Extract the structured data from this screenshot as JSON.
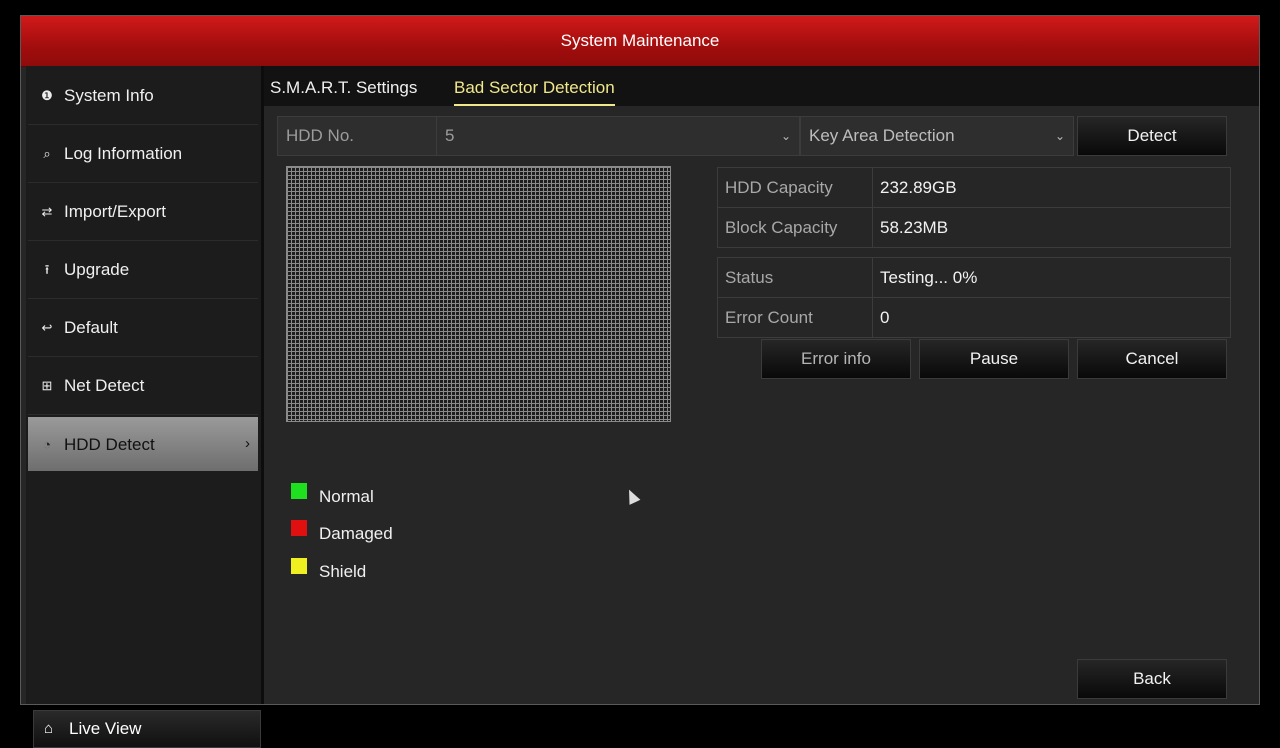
{
  "window": {
    "title": "System Maintenance"
  },
  "sidebar": {
    "items": [
      {
        "label": "System Info",
        "icon": "info-icon",
        "glyph": "❶"
      },
      {
        "label": "Log Information",
        "icon": "log-search-icon",
        "glyph": "⌕"
      },
      {
        "label": "Import/Export",
        "icon": "import-export-icon",
        "glyph": "⇄"
      },
      {
        "label": "Upgrade",
        "icon": "upgrade-arrow-icon",
        "glyph": "⭱"
      },
      {
        "label": "Default",
        "icon": "default-reset-icon",
        "glyph": "↩"
      },
      {
        "label": "Net Detect",
        "icon": "network-icon",
        "glyph": "⊞"
      },
      {
        "label": "HDD Detect",
        "icon": "hdd-detect-icon",
        "glyph": "◔",
        "active": true
      }
    ],
    "live_view": {
      "label": "Live View",
      "icon": "home-icon",
      "glyph": "⌂"
    }
  },
  "tabs": [
    {
      "label": "S.M.A.R.T. Settings",
      "active": false
    },
    {
      "label": "Bad Sector Detection",
      "active": true
    }
  ],
  "controls": {
    "hdd_label": "HDD No.",
    "hdd_value": "5",
    "mode_value": "Key Area Detection",
    "detect_label": "Detect"
  },
  "info": {
    "capacity": [
      {
        "key": "HDD Capacity",
        "value": "232.89GB"
      },
      {
        "key": "Block Capacity",
        "value": "58.23MB"
      }
    ],
    "status": [
      {
        "key": "Status",
        "value": "Testing... 0%"
      },
      {
        "key": "Error Count",
        "value": "0"
      }
    ]
  },
  "buttons": {
    "error_info": "Error info",
    "pause": "Pause",
    "cancel": "Cancel",
    "back": "Back"
  },
  "legend": [
    {
      "label": "Normal",
      "color": "#1fe01f"
    },
    {
      "label": "Damaged",
      "color": "#e01010"
    },
    {
      "label": "Shield",
      "color": "#f0f020"
    }
  ]
}
